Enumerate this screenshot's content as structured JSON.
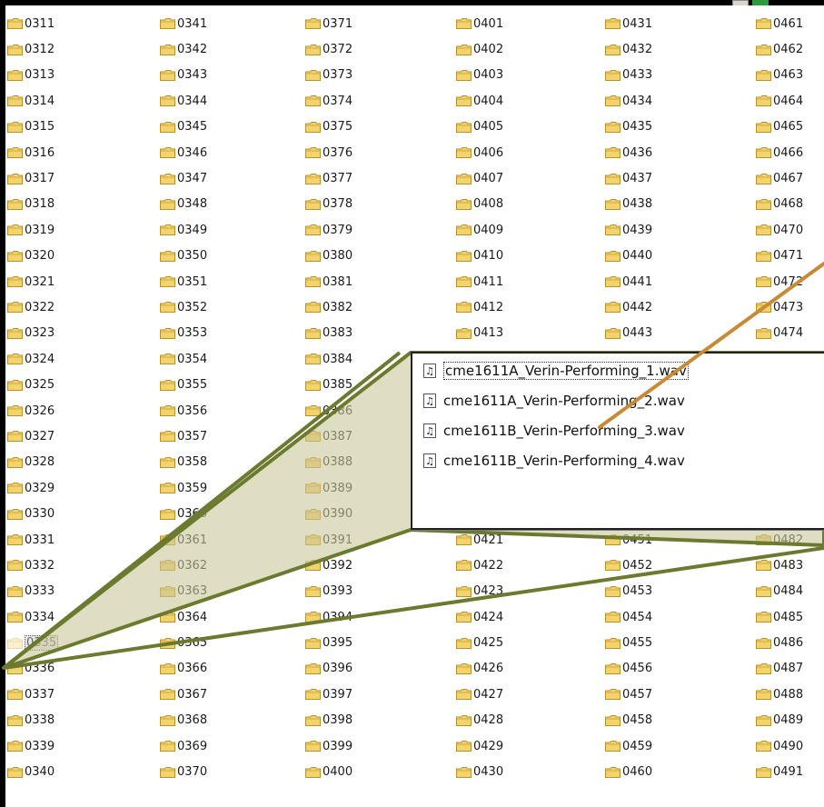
{
  "folders": [
    [
      "0311",
      "0312",
      "0313",
      "0314",
      "0315",
      "0316",
      "0317",
      "0318",
      "0319",
      "0320",
      "0321",
      "0322",
      "0323",
      "0324",
      "0325",
      "0326",
      "0327",
      "0328",
      "0329",
      "0330",
      "0331",
      "0332",
      "0333",
      "0334",
      "0335",
      "0336",
      "0337",
      "0338",
      "0339",
      "0340"
    ],
    [
      "0341",
      "0342",
      "0343",
      "0344",
      "0345",
      "0346",
      "0347",
      "0348",
      "0349",
      "0350",
      "0351",
      "0352",
      "0353",
      "0354",
      "0355",
      "0356",
      "0357",
      "0358",
      "0359",
      "0360",
      "0361",
      "0362",
      "0363",
      "0364",
      "0365",
      "0366",
      "0367",
      "0368",
      "0369",
      "0370"
    ],
    [
      "0371",
      "0372",
      "0373",
      "0374",
      "0375",
      "0376",
      "0377",
      "0378",
      "0379",
      "0380",
      "0381",
      "0382",
      "0383",
      "0384",
      "0385",
      "0386",
      "0387",
      "0388",
      "0389",
      "0390",
      "0391",
      "0392",
      "0393",
      "0394",
      "0395",
      "0396",
      "0397",
      "0398",
      "0399",
      "0400"
    ],
    [
      "0401",
      "0402",
      "0403",
      "0404",
      "0405",
      "0406",
      "0407",
      "0408",
      "0409",
      "0410",
      "0411",
      "0412",
      "0413",
      "",
      "",
      "",
      "",
      "",
      "",
      "",
      "0421",
      "0422",
      "0423",
      "0424",
      "0425",
      "0426",
      "0427",
      "0428",
      "0429",
      "0430"
    ],
    [
      "0431",
      "0432",
      "0433",
      "0434",
      "0435",
      "0436",
      "0437",
      "0438",
      "0439",
      "0440",
      "0441",
      "0442",
      "0443",
      "",
      "",
      "",
      "",
      "",
      "",
      "",
      "0451",
      "0452",
      "0453",
      "0454",
      "0455",
      "0456",
      "0457",
      "0458",
      "0459",
      "0460"
    ],
    [
      "0461",
      "0462",
      "0463",
      "0464",
      "0465",
      "0466",
      "0467",
      "0468",
      "0470",
      "0471",
      "0472",
      "0473",
      "0474",
      "",
      "",
      "",
      "",
      "",
      "",
      "",
      "0482",
      "0483",
      "0484",
      "0485",
      "0486",
      "0487",
      "0488",
      "0489",
      "0490",
      "0491"
    ]
  ],
  "selected_folder": "0335",
  "popup_files": [
    "cme1611A_Verin-Performing_1.wav",
    "cme1611A_Verin-Performing_2.wav",
    "cme1611B_Verin-Performing_3.wav",
    "cme1611B_Verin-Performing_4.wav"
  ],
  "icons": {
    "folder": "folder-icon",
    "audio_file": "audio-file-icon",
    "note_glyph": "♫"
  },
  "colors": {
    "folder_fill": "#f3d36b",
    "folder_stroke": "#b8902c",
    "callout_fill": "#c9c69a",
    "callout_stroke": "#6b7a2e",
    "arrow": "#c98a35"
  }
}
